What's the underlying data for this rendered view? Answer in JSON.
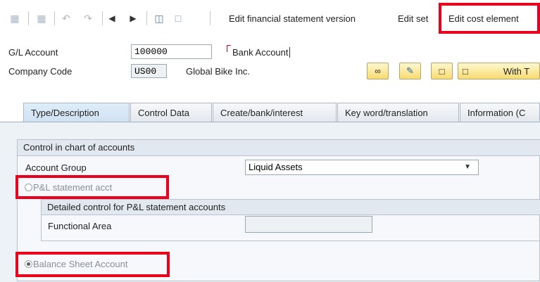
{
  "toolbar": {
    "edit_fs_version_label": "Edit financial statement version",
    "edit_set_label": "Edit set",
    "edit_cost_element_label": "Edit cost element"
  },
  "header": {
    "gl_account_label": "G/L Account",
    "gl_account_value": "100000",
    "gl_account_name": "Bank Account",
    "company_code_label": "Company Code",
    "company_code_value": "US00",
    "company_name": "Global Bike Inc.",
    "with_template_label": "With T"
  },
  "tabs": [
    {
      "label": "Type/Description"
    },
    {
      "label": "Control Data"
    },
    {
      "label": "Create/bank/interest"
    },
    {
      "label": "Key word/translation"
    },
    {
      "label": "Information (C"
    }
  ],
  "control_group": {
    "title": "Control in chart of accounts",
    "account_group_label": "Account Group",
    "account_group_value": "Liquid Assets",
    "pl_radio_label": "P&L statement acct",
    "detailed_title": "Detailed control for P&L statement accounts",
    "functional_area_label": "Functional Area",
    "functional_area_value": "",
    "balance_radio_label": "Balance Sheet Account"
  },
  "colors": {
    "highlight": "#e8001c",
    "tab_active": "#cfe1f3"
  }
}
